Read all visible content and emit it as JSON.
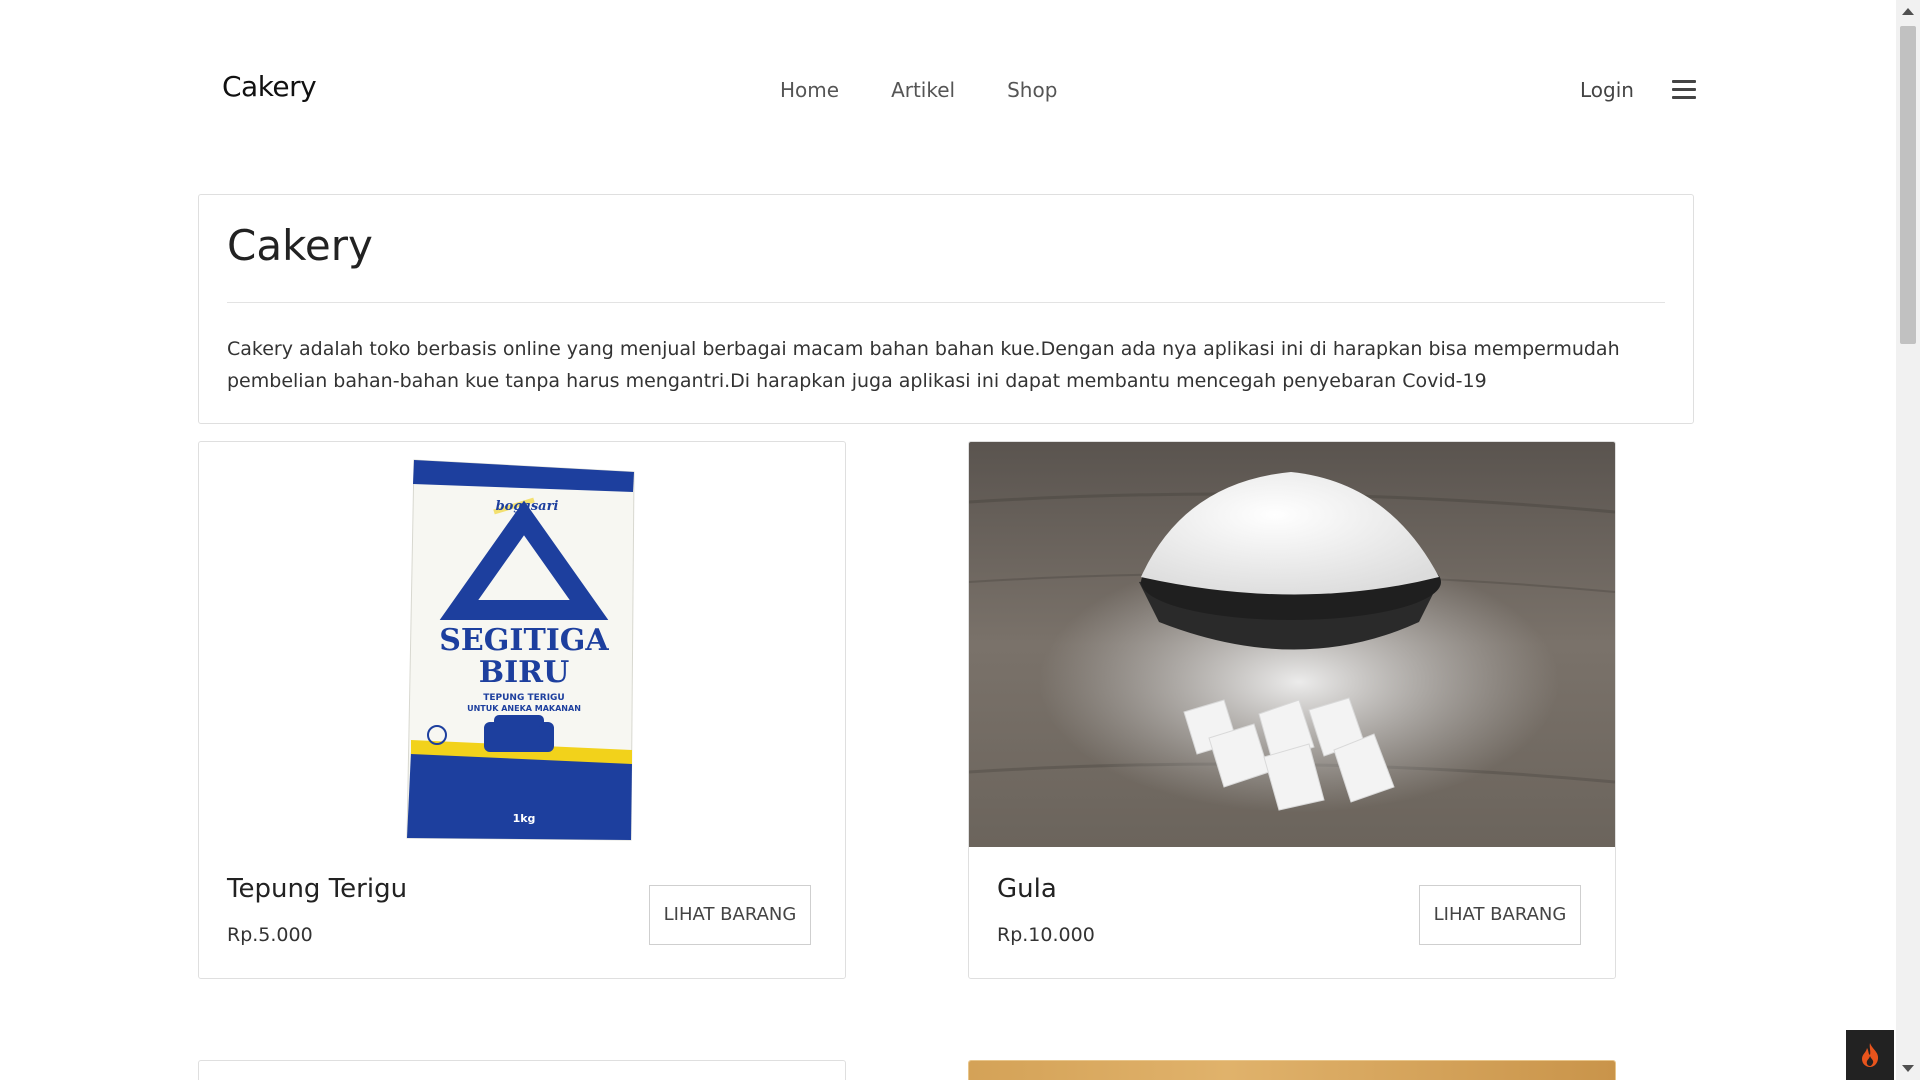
{
  "navbar": {
    "brand": "Cakery",
    "links": [
      "Home",
      "Artikel",
      "Shop"
    ],
    "login": "Login",
    "menu_icon": "hamburger-icon"
  },
  "intro": {
    "title": "Cakery",
    "description": "Cakery adalah toko berbasis online yang menjual berbagai macam bahan bahan kue.Dengan ada nya aplikasi ini di harapkan bisa mempermudah pembelian bahan-bahan kue tanpa harus mengantri.Di harapkan juga aplikasi ini dapat membantu mencegah penyebaran Covid-19"
  },
  "products": [
    {
      "name": "Tepung Terigu",
      "price": "Rp.5.000",
      "button": "LIHAT BARANG",
      "image": {
        "brand_text": "bogasari",
        "product_line_1": "SEGITIGA",
        "product_line_2": "BIRU",
        "subtitle_1": "TEPUNG TERIGU",
        "subtitle_2": "UNTUK ANEKA MAKANAN",
        "weight": "1kg"
      }
    },
    {
      "name": "Gula",
      "price": "Rp.10.000",
      "button": "LIHAT BARANG"
    }
  ],
  "colors": {
    "bag_blue": "#1d3f9e",
    "bag_yellow": "#f2d21b",
    "debug_flame": "#e8541c"
  }
}
